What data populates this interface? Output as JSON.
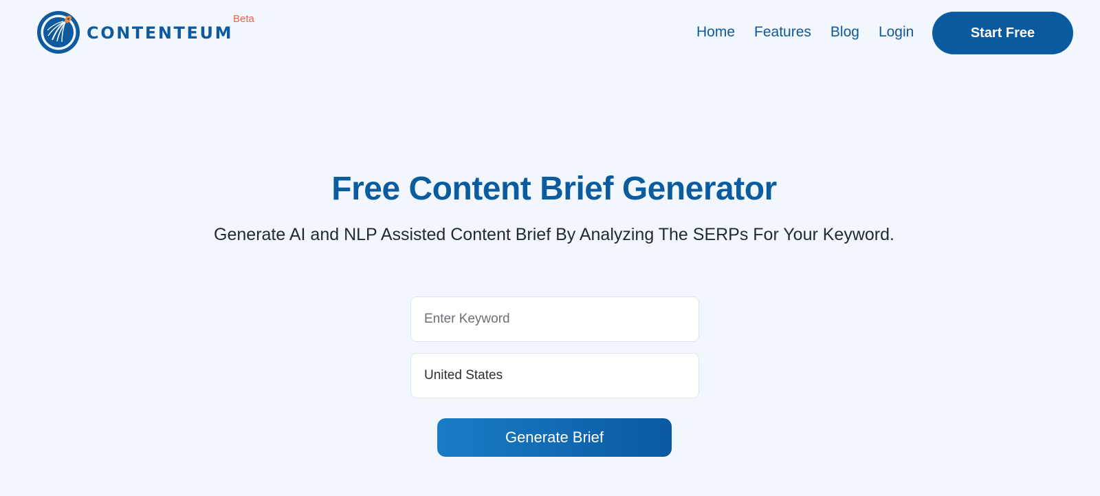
{
  "brand": {
    "name": "CONTENTEUM",
    "badge": "Beta",
    "accent_color": "#0b5b9f",
    "badge_color": "#f0614a"
  },
  "nav": {
    "items": [
      {
        "label": "Home"
      },
      {
        "label": "Features"
      },
      {
        "label": "Blog"
      },
      {
        "label": "Login"
      }
    ],
    "cta_label": "Start Free"
  },
  "hero": {
    "title": "Free Content Brief Generator",
    "subtitle": "Generate AI and NLP Assisted Content Brief By Analyzing The SERPs For Your Keyword."
  },
  "form": {
    "keyword_placeholder": "Enter Keyword",
    "keyword_value": "",
    "country_value": "United States",
    "submit_label": "Generate Brief"
  }
}
